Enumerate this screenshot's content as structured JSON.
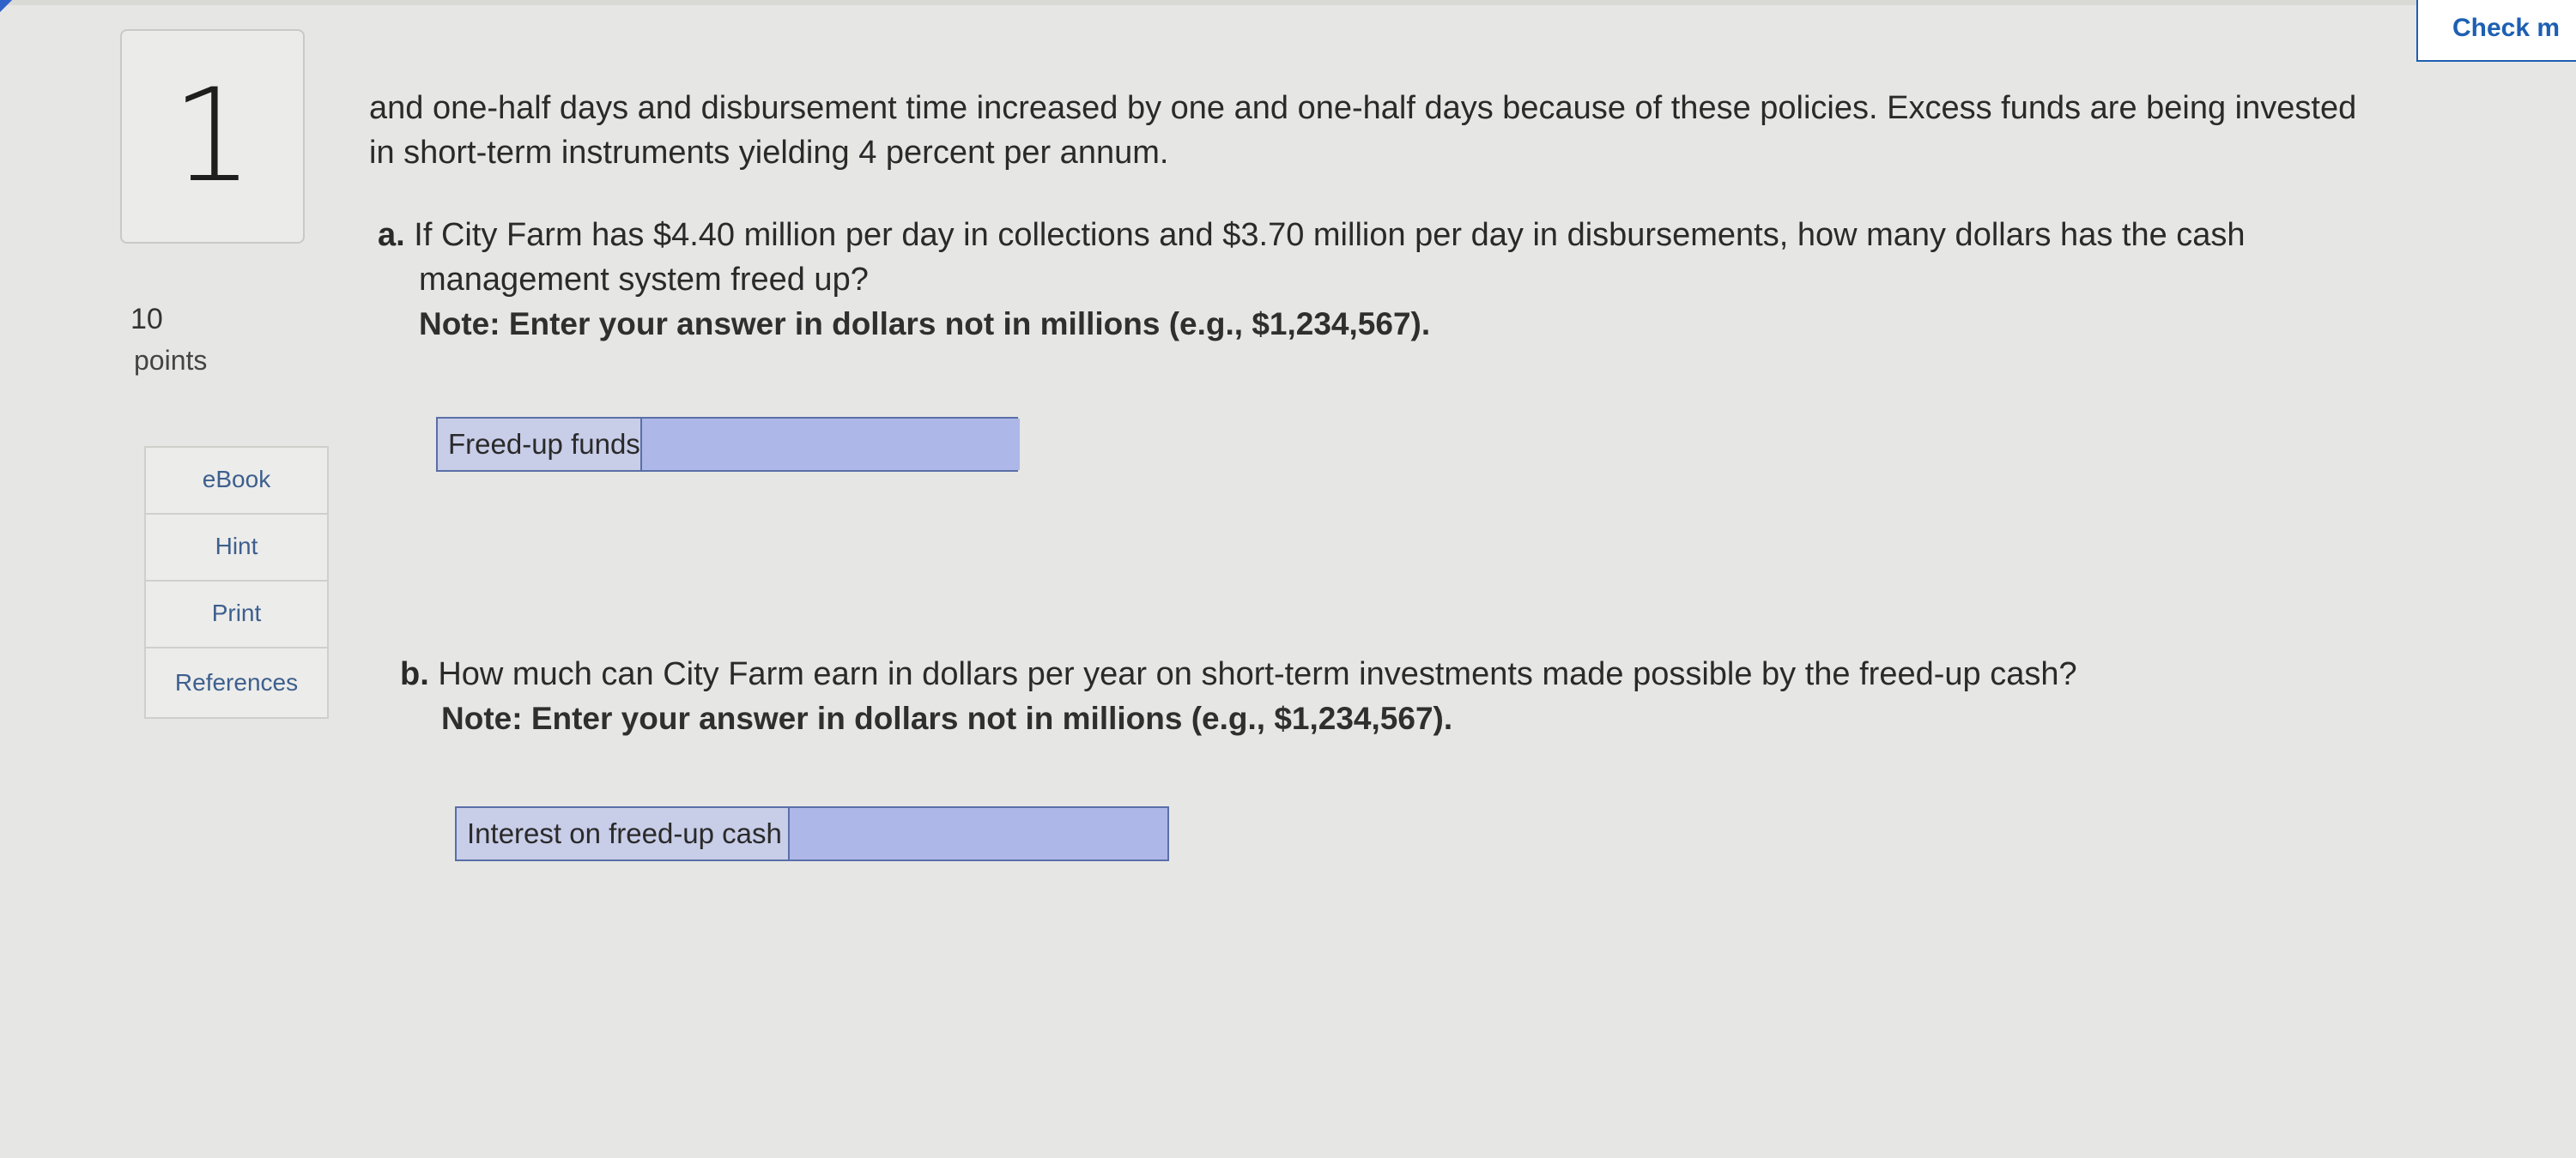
{
  "header": {
    "check_button_label": "Check m"
  },
  "question": {
    "number": "1",
    "points_value": "10",
    "points_label": "points"
  },
  "sidebar": {
    "links": [
      {
        "label": "eBook"
      },
      {
        "label": "Hint"
      },
      {
        "label": "Print"
      },
      {
        "label": "References"
      }
    ]
  },
  "content": {
    "intro": "and one-half days and disbursement time increased by one and one-half days because of these policies. Excess funds are being invested in short-term instruments yielding 4 percent per annum.",
    "part_a": {
      "label": "a.",
      "question": "If City Farm has $4.40 million per day in collections and $3.70 million per day in disbursements, how many dollars has the cash management system freed up?",
      "note": "Note: Enter your answer in dollars not in millions (e.g., $1,234,567).",
      "field_label": "Freed-up funds",
      "field_value": ""
    },
    "part_b": {
      "label": "b.",
      "question": "How much can City Farm earn in dollars per year on short-term investments made possible by the freed-up cash?",
      "note": "Note: Enter your answer in dollars not in millions (e.g., $1,234,567).",
      "field_label": "Interest on freed-up cash",
      "field_value": ""
    }
  },
  "colors": {
    "accent_blue": "#1d5fb3",
    "input_fill": "#aeb8e8",
    "label_fill": "#c8cde8"
  }
}
